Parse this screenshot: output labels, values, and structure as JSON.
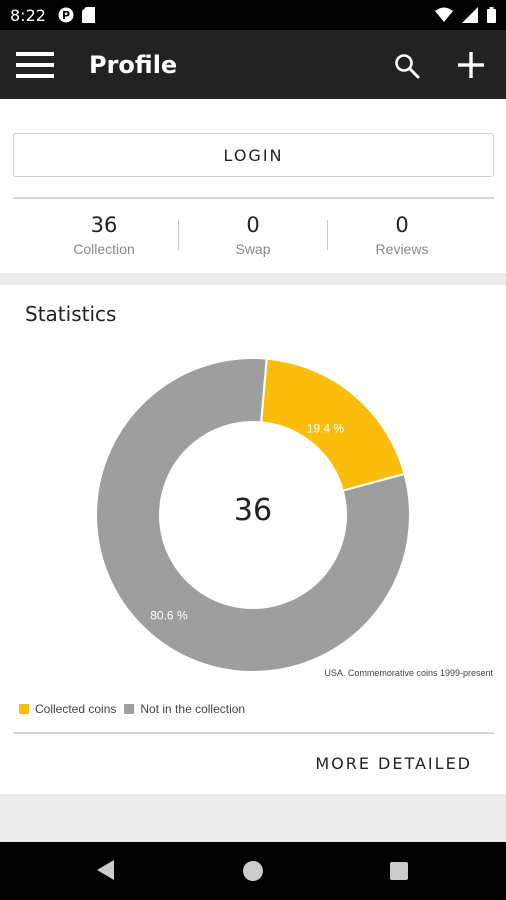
{
  "status_bar": {
    "time": "8:22"
  },
  "app_bar": {
    "title": "Profile"
  },
  "profile": {
    "login_label": "LOGIN",
    "stats": [
      {
        "value": "36",
        "label": "Collection"
      },
      {
        "value": "0",
        "label": "Swap"
      },
      {
        "value": "0",
        "label": "Reviews"
      }
    ]
  },
  "statistics": {
    "title": "Statistics",
    "more_label": "MORE DETAILED"
  },
  "chart_data": {
    "type": "pie",
    "center_value": "36",
    "caption": "USA. Commemorative coins 1999-present",
    "slices": [
      {
        "name": "Collected coins",
        "value": 19.4,
        "label": "19.4 %",
        "color": "#fbbd0b"
      },
      {
        "name": "Not in the collection",
        "value": 80.6,
        "label": "80.6 %",
        "color": "#9e9e9e"
      }
    ]
  }
}
